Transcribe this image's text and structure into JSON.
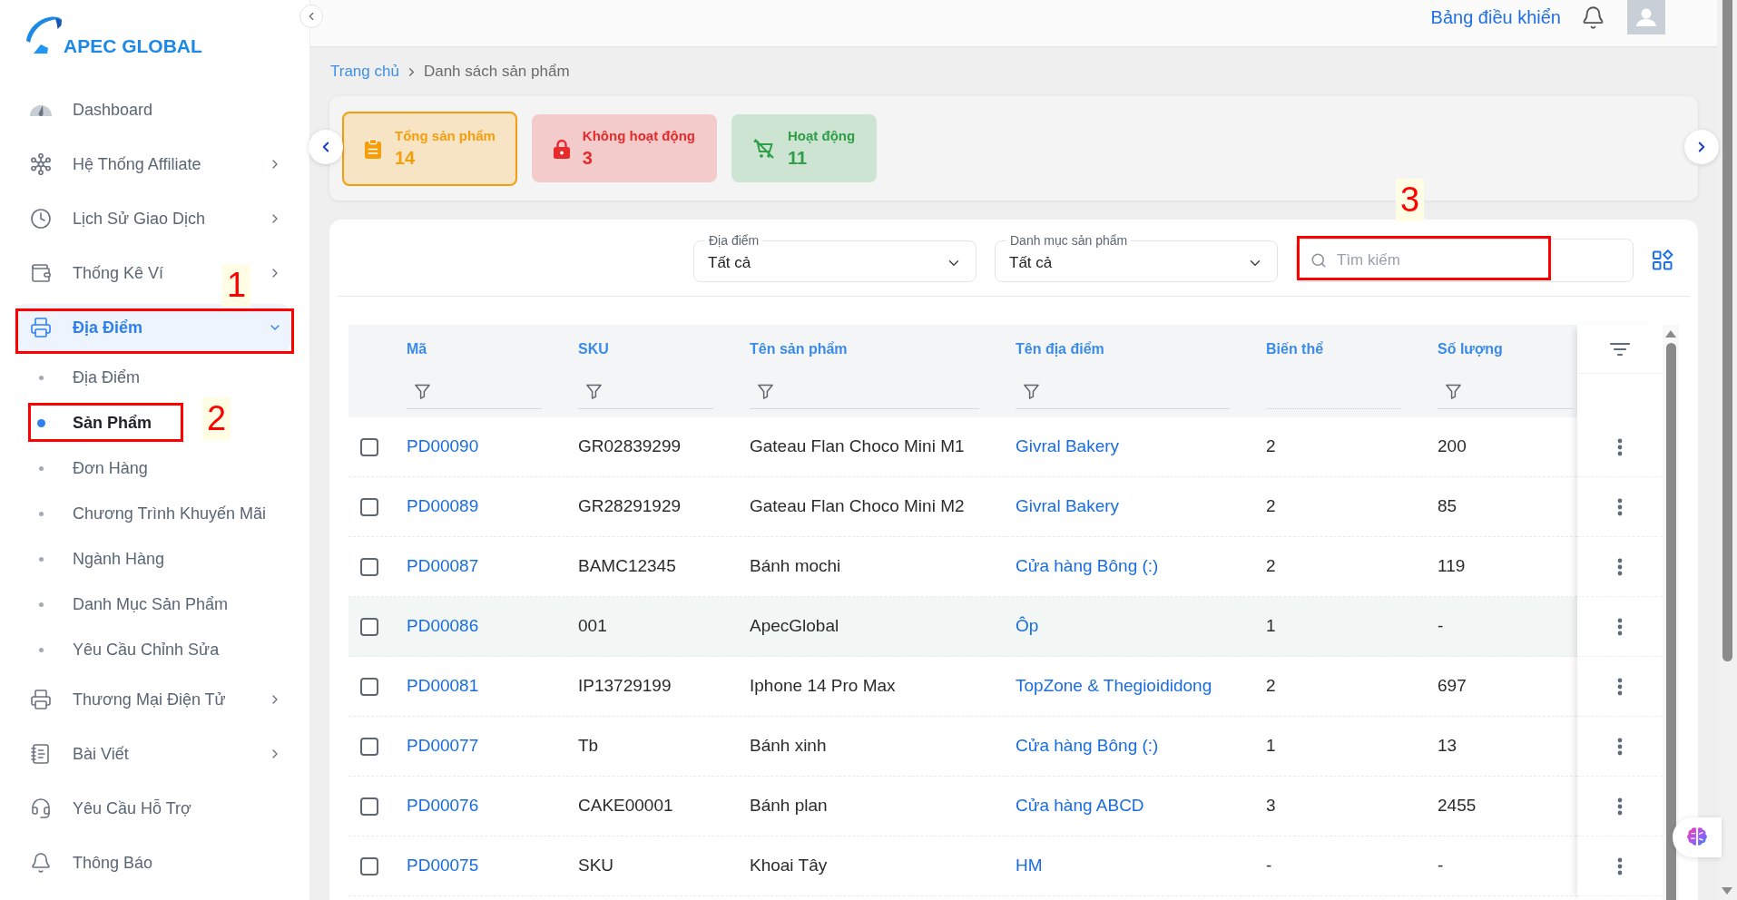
{
  "logo": {
    "text": "APEC GLOBAL"
  },
  "sidebar": {
    "items": [
      {
        "label": "Dashboard",
        "selected": false
      },
      {
        "label": "Hệ Thống Affiliate",
        "selected": false,
        "expanded": false
      },
      {
        "label": "Lịch Sử Giao Dịch",
        "selected": false,
        "expanded": false
      },
      {
        "label": "Thống Kê Ví",
        "selected": false,
        "expanded": false
      },
      {
        "label": "Địa Điểm",
        "selected": true,
        "expanded": true,
        "annotation": "1",
        "children": [
          {
            "label": "Địa Điểm",
            "selected": false
          },
          {
            "label": "Sản Phẩm",
            "selected": true,
            "annotation": "2"
          },
          {
            "label": "Đơn Hàng",
            "selected": false
          },
          {
            "label": "Chương Trình Khuyến Mãi",
            "selected": false
          },
          {
            "label": "Ngành Hàng",
            "selected": false
          },
          {
            "label": "Danh Mục Sản Phẩm",
            "selected": false
          },
          {
            "label": "Yêu Cầu Chỉnh Sửa",
            "selected": false
          }
        ]
      },
      {
        "label": "Thương Mại Điện Tử",
        "selected": false,
        "expanded": false
      },
      {
        "label": "Bài Viết",
        "selected": false,
        "expanded": false
      },
      {
        "label": "Yêu Cầu Hỗ Trợ",
        "selected": false
      },
      {
        "label": "Thông Báo",
        "selected": false
      }
    ]
  },
  "header": {
    "link": "Bảng điều khiển"
  },
  "breadcrumb": [
    {
      "label": "Trang chủ"
    },
    {
      "label": "Danh sách sản phẩm"
    }
  ],
  "summary_cards": [
    {
      "title": "Tổng sản phẩm",
      "count": "14",
      "color": "#f59e0b",
      "selected": true
    },
    {
      "title": "Không hoạt động",
      "count": "3",
      "color": "#e52b2b",
      "selected": false
    },
    {
      "title": "Hoạt động",
      "count": "11",
      "color": "#2e9e47",
      "selected": false
    }
  ],
  "filters": {
    "location": {
      "label": "Địa điểm",
      "value": "Tất cả"
    },
    "category": {
      "label": "Danh mục sản phẩm",
      "value": "Tất cả"
    },
    "search": {
      "placeholder": "Tìm kiếm",
      "annotation": "3"
    }
  },
  "table": {
    "columns": [
      {
        "label": "Mã",
        "filterable": true
      },
      {
        "label": "SKU",
        "filterable": true
      },
      {
        "label": "Tên sản phẩm",
        "filterable": true
      },
      {
        "label": "Tên địa điểm",
        "filterable": true
      },
      {
        "label": "Biến thể",
        "filterable": false
      },
      {
        "label": "Số lượng",
        "filterable": true
      }
    ],
    "rows": [
      {
        "code": "PD00090",
        "sku": "GR02839299",
        "name": "Gateau Flan Choco Mini M1",
        "location": "Givral Bakery",
        "variants": "2",
        "quantity": "200",
        "checked": false,
        "hovered": false
      },
      {
        "code": "PD00089",
        "sku": "GR28291929",
        "name": "Gateau Flan Choco Mini M2",
        "location": "Givral Bakery",
        "variants": "2",
        "quantity": "85",
        "checked": false,
        "hovered": false
      },
      {
        "code": "PD00087",
        "sku": "BAMC12345",
        "name": "Bánh mochi",
        "location": "Cửa hàng Bông (:)",
        "variants": "2",
        "quantity": "119",
        "checked": false,
        "hovered": false
      },
      {
        "code": "PD00086",
        "sku": "001",
        "name": "ApecGlobal",
        "location": "Ôp",
        "variants": "1",
        "quantity": "-",
        "checked": false,
        "hovered": true
      },
      {
        "code": "PD00081",
        "sku": "IP13729199",
        "name": "Iphone 14 Pro Max",
        "location": "TopZone & Thegioididong",
        "variants": "2",
        "quantity": "697",
        "checked": false,
        "hovered": false
      },
      {
        "code": "PD00077",
        "sku": "Tb",
        "name": "Bánh xinh",
        "location": "Cửa hàng Bông (:)",
        "variants": "1",
        "quantity": "13",
        "checked": false,
        "hovered": false
      },
      {
        "code": "PD00076",
        "sku": "CAKE00001",
        "name": "Bánh plan",
        "location": "Cửa hàng ABCD",
        "variants": "3",
        "quantity": "2455",
        "checked": false,
        "hovered": false
      },
      {
        "code": "PD00075",
        "sku": "SKU",
        "name": "Khoai Tây",
        "location": "HM",
        "variants": "-",
        "quantity": "-",
        "checked": false,
        "hovered": false
      }
    ]
  }
}
